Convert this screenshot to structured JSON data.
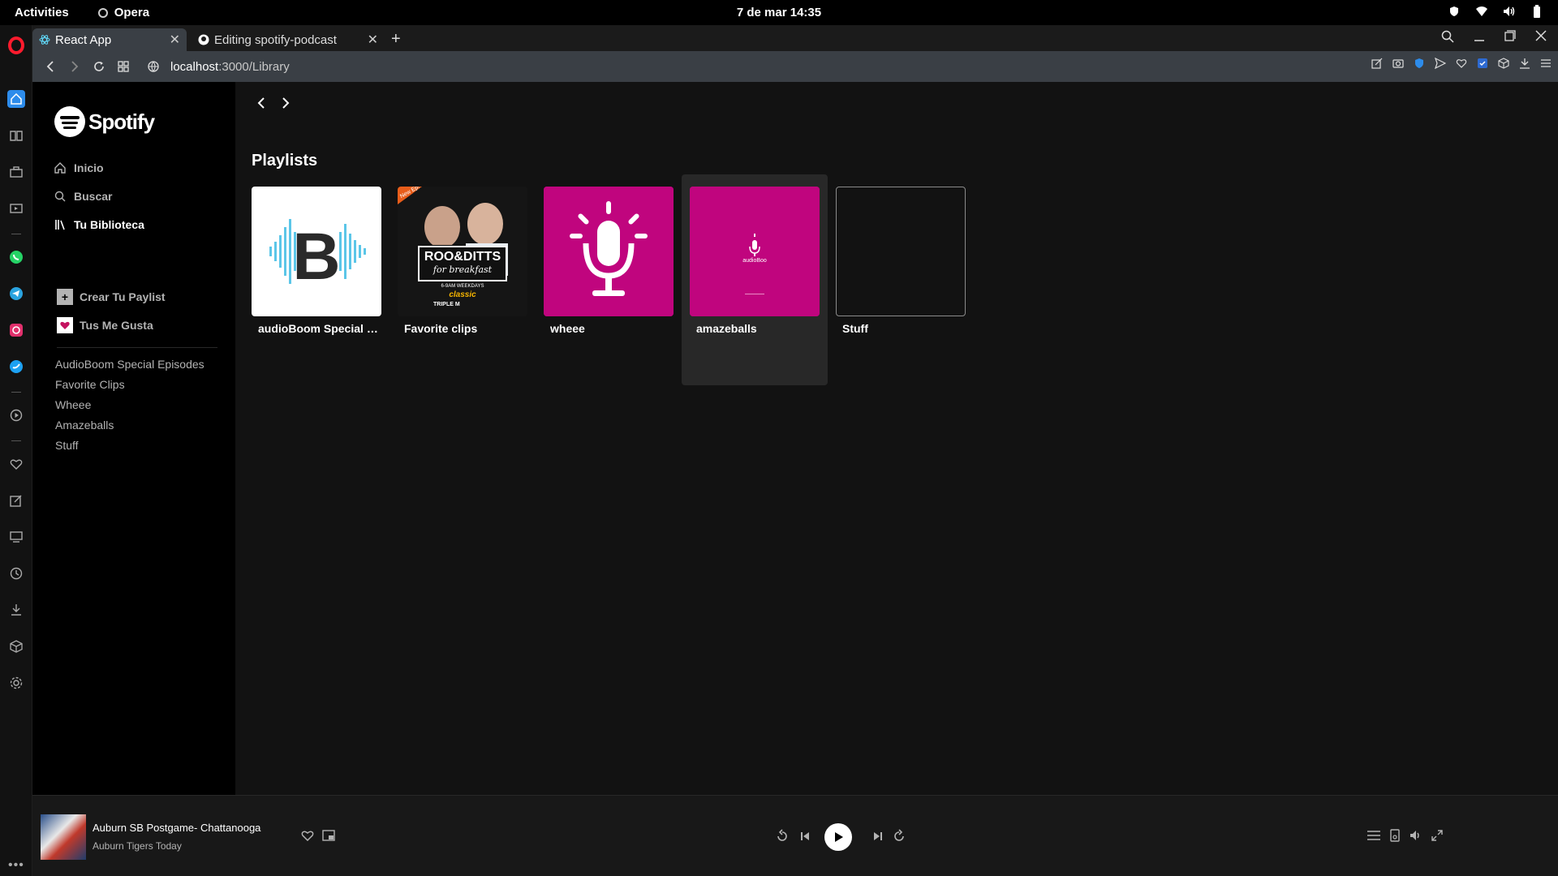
{
  "system_bar": {
    "activities": "Activities",
    "app_name": "Opera",
    "clock": "7 de mar  14:35"
  },
  "browser": {
    "tabs": [
      {
        "title": "React App",
        "active": true
      },
      {
        "title": "Editing spotify-podcast",
        "active": false
      }
    ],
    "url_host": "localhost",
    "url_path": ":3000/Library"
  },
  "spotify": {
    "logo_text": "Spotify",
    "nav": [
      {
        "label": "Inicio"
      },
      {
        "label": "Buscar"
      },
      {
        "label": "Tu Biblioteca"
      }
    ],
    "actions": {
      "create_playlist": "Crear Tu Paylist",
      "liked": "Tus Me Gusta"
    },
    "sidebar_playlists": [
      "AudioBoom Special Episodes",
      "Favorite Clips",
      "Wheee",
      "Amazeballs",
      "Stuff"
    ],
    "main": {
      "section_title": "Playlists",
      "cards": [
        {
          "title": "audioBoom Special E...",
          "cover": "audioboom-logo"
        },
        {
          "title": "Favorite clips",
          "cover": "roo-ditts-podcast-art"
        },
        {
          "title": "wheee",
          "cover": "pink-microphone"
        },
        {
          "title": "amazeballs",
          "cover": "pink-small-logo",
          "cover_text": "audioBoo"
        },
        {
          "title": "Stuff",
          "cover": "empty"
        }
      ],
      "roo_cover_text": {
        "line1": "ROO&DITTS",
        "line2": "for breakfast",
        "line3": "6-9AM WEEKDAYS",
        "badge": "New Ep!",
        "brand": "classic",
        "station": "TRIPLE M"
      }
    },
    "player": {
      "title": "Auburn SB Postgame- Chattanooga",
      "artist": "Auburn Tigers Today"
    }
  },
  "colors": {
    "accent_pink": "#c0057e",
    "opera_blue": "#2d8ceb",
    "opera_red": "#ff1b2d"
  }
}
